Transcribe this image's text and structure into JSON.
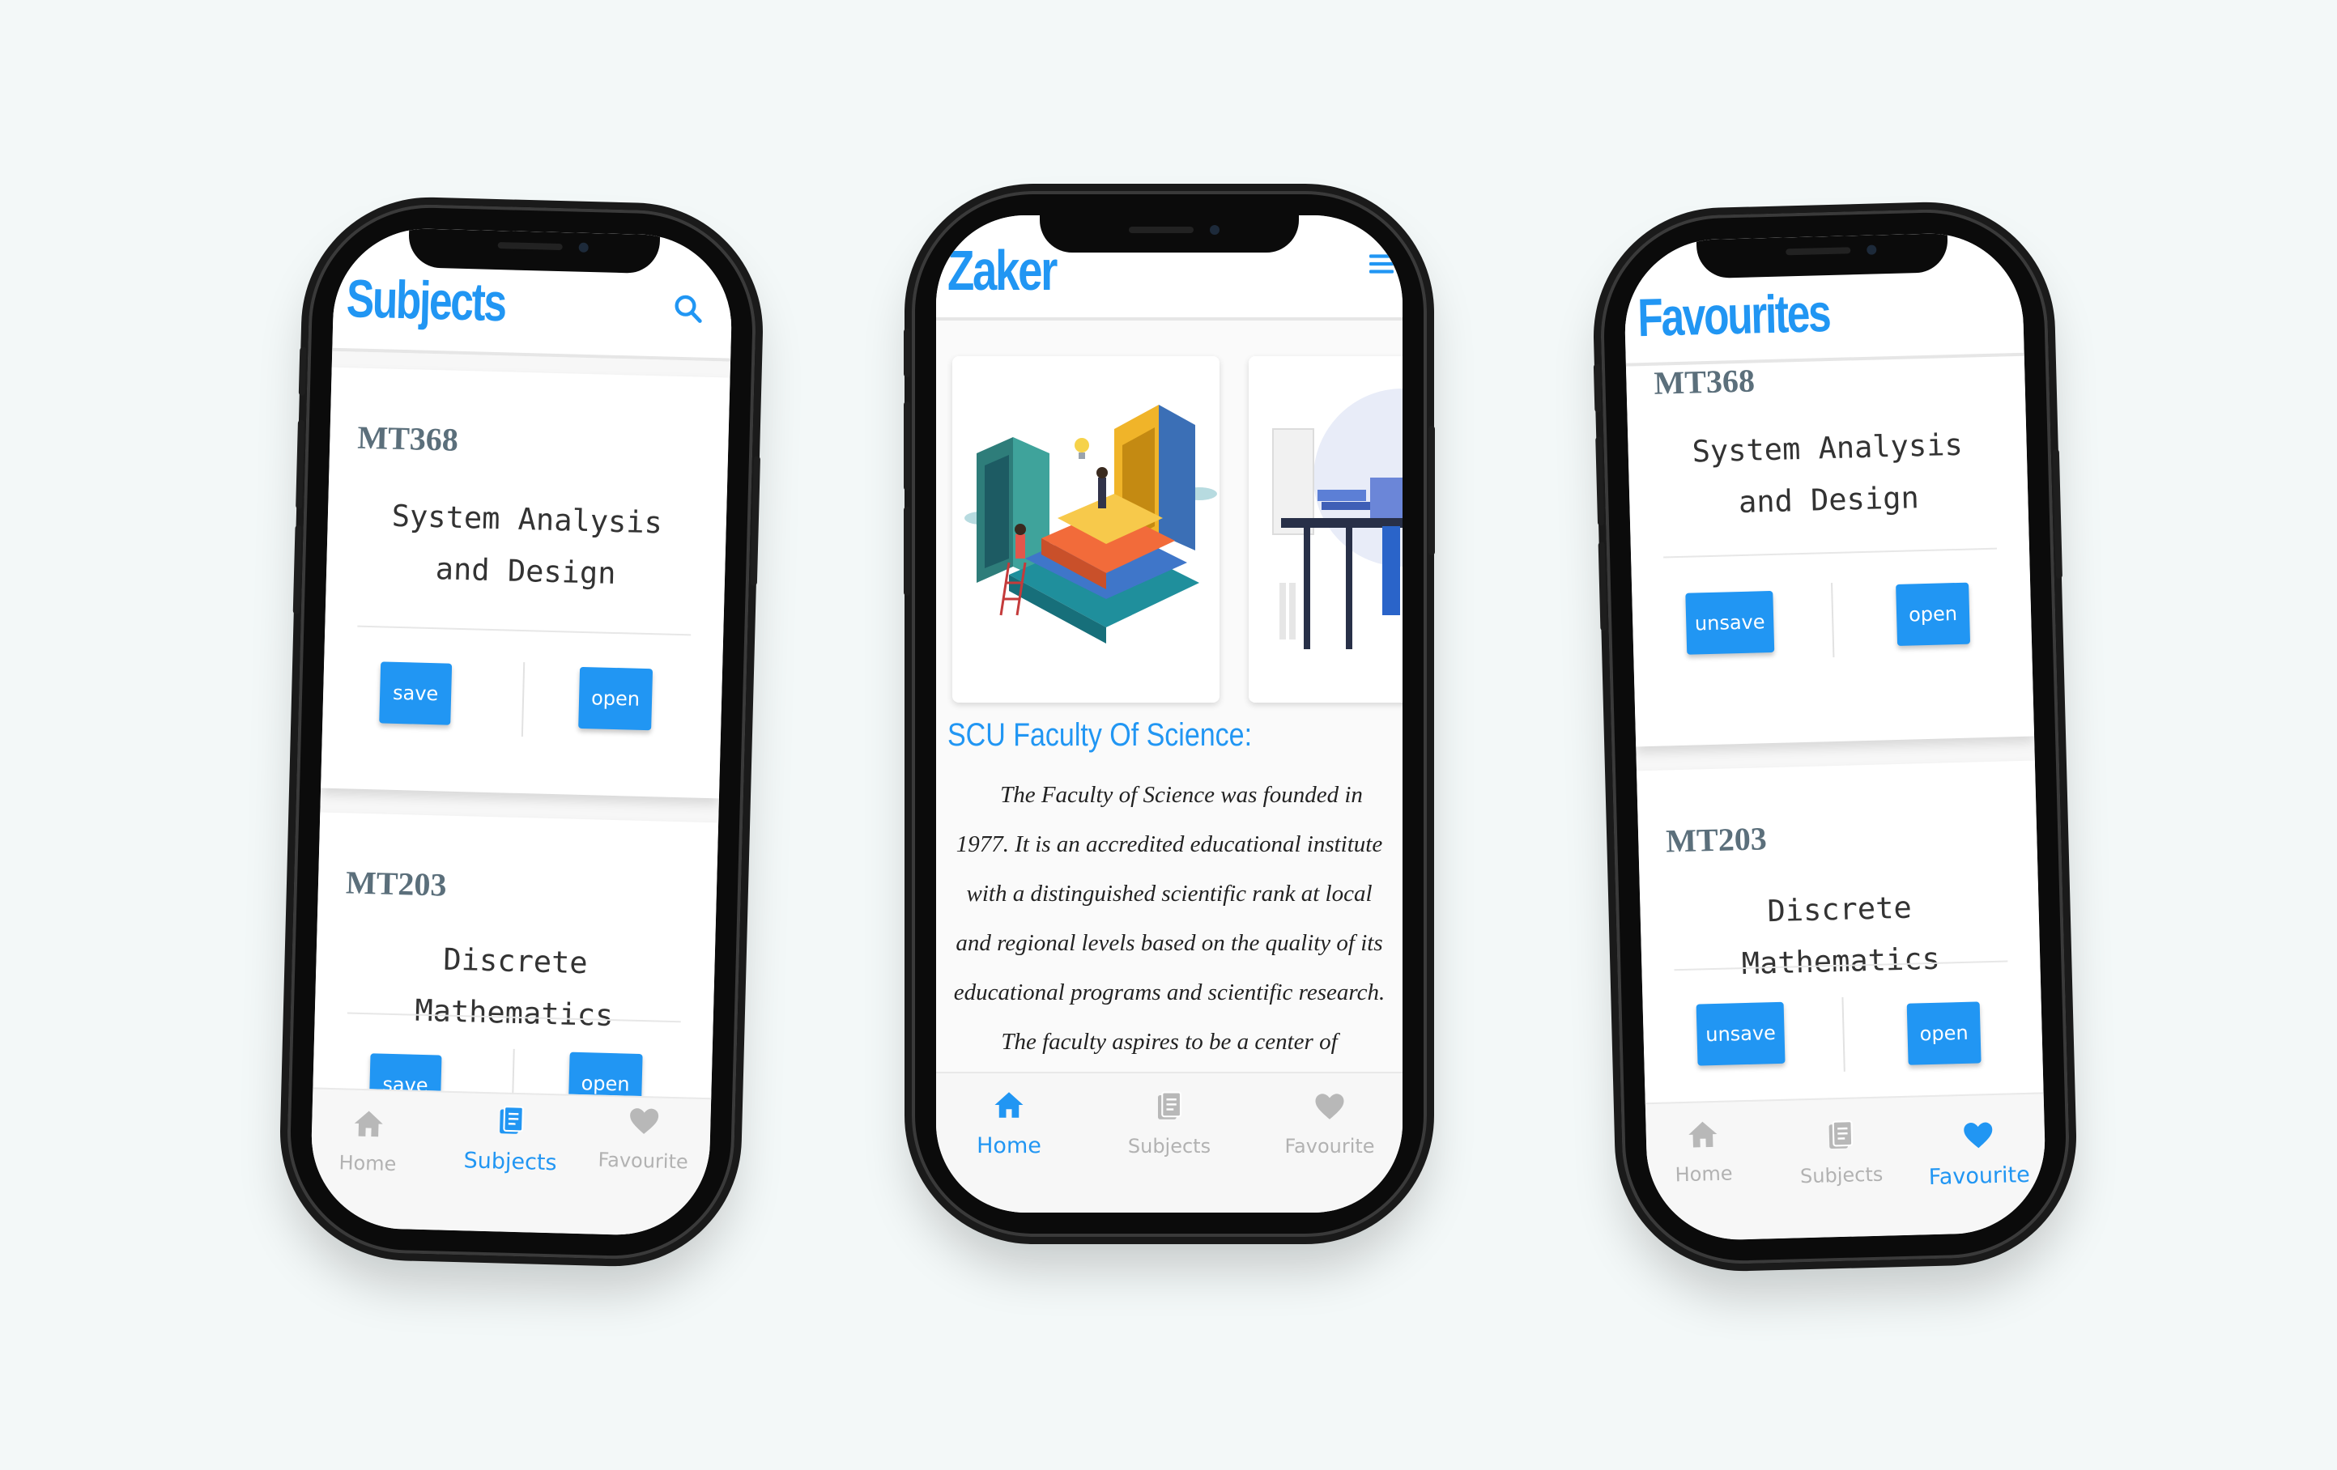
{
  "colors": {
    "accent": "#2196f3",
    "code": "#5b6f7b",
    "background": "#f3f8f8"
  },
  "subjects_screen": {
    "title": "Subjects",
    "search_icon": "search-icon",
    "cards": [
      {
        "code": "MT368",
        "name": "System Analysis and Design",
        "left_button": "save",
        "right_button": "open"
      },
      {
        "code": "MT203",
        "name": "Discrete Mathematics",
        "left_button": "save",
        "right_button": "open"
      }
    ],
    "nav": [
      {
        "label": "Home",
        "icon": "home-icon",
        "active": false
      },
      {
        "label": "Subjects",
        "icon": "book-icon",
        "active": true
      },
      {
        "label": "Favourite",
        "icon": "heart-icon",
        "active": false
      }
    ]
  },
  "home_screen": {
    "title": "Zaker",
    "menu_icon": "menu-icon",
    "section_title": "SCU Faculty Of Science:",
    "about_text": "The Faculty of Science was founded in 1977. It is an accredited educational institute with a distinguished scientific rank at local and regional levels based on the quality of its educational programs and scientific research. The faculty aspires to be a center of experience providing scientific consultations and",
    "nav": [
      {
        "label": "Home",
        "icon": "home-icon",
        "active": true
      },
      {
        "label": "Subjects",
        "icon": "book-icon",
        "active": false
      },
      {
        "label": "Favourite",
        "icon": "heart-icon",
        "active": false
      }
    ]
  },
  "favourites_screen": {
    "title": "Favourites",
    "cards": [
      {
        "code": "MT368",
        "name": "System Analysis and Design",
        "left_button": "unsave",
        "right_button": "open"
      },
      {
        "code": "MT203",
        "name": "Discrete Mathematics",
        "left_button": "unsave",
        "right_button": "open"
      }
    ],
    "nav": [
      {
        "label": "Home",
        "icon": "home-icon",
        "active": false
      },
      {
        "label": "Subjects",
        "icon": "book-icon",
        "active": false
      },
      {
        "label": "Favourite",
        "icon": "heart-icon",
        "active": true
      }
    ]
  }
}
